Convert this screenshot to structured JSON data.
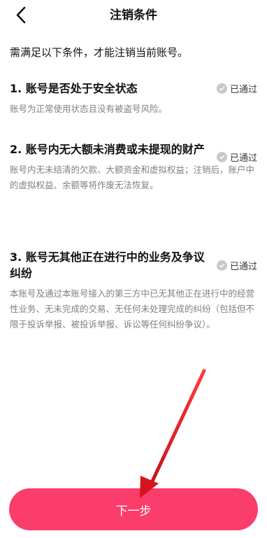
{
  "header": {
    "title": "注销条件",
    "back_icon": "chevron-left-icon"
  },
  "intro": "需满足以下条件，才能注销当前账号。",
  "conditions": [
    {
      "title": "1. 账号是否处于安全状态",
      "description": "账号为正常使用状态且没有被盗号风险。",
      "status": "已通过"
    },
    {
      "title": "2. 账号内无大额未消费或未提现的财产",
      "description": "账号内无未结清的欠款、大额资金和虚拟权益；注销后，账户中的虚拟权益、余额等将作废无法恢复。",
      "status": "已通过"
    },
    {
      "title": "3. 账号无其他正在进行中的业务及争议纠纷",
      "description": "本账号及通过本账号接入的第三方中已无其他正在进行中的经营性业务、无未完成的交易、无任何未处理完成的纠纷（包括但不限于投诉举报、被投诉举报、诉讼等任何纠纷争议）。",
      "status": "已通过"
    }
  ],
  "next_button": "下一步",
  "colors": {
    "primary": "#fa3d6b",
    "annotation_arrow": "#e8202a",
    "badge_check": "#c9c9c9"
  }
}
